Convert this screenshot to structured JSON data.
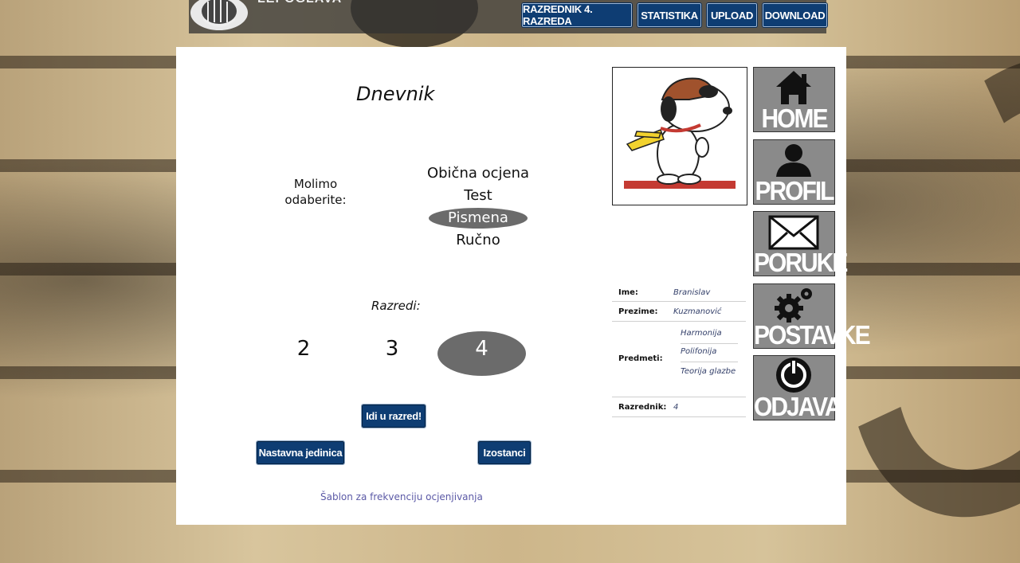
{
  "header": {
    "logo_text": "LEPOGLAVA",
    "nav": [
      "RAZREDNIK 4. RAZREDA",
      "STATISTIKA",
      "UPLOAD",
      "DOWNLOAD"
    ]
  },
  "main": {
    "title": "Dnevnik",
    "prompt": "Molimo odaberite:",
    "options": [
      "Obična ocjena",
      "Test",
      "Pismena",
      "Ručno"
    ],
    "selected_option": "Pismena",
    "grades_label": "Razredi:",
    "grades": [
      "2",
      "3",
      "4"
    ],
    "selected_grade": "4",
    "go_button": "Idi u razred!",
    "lesson_button": "Nastavna jedinica",
    "absence_button": "Izostanci",
    "template_link": "Šablon za frekvenciju ocjenjivanja"
  },
  "profile": {
    "name_label": "Ime:",
    "name": "Branislav",
    "surname_label": "Prezime:",
    "surname": "Kuzmanović",
    "subjects_label": "Predmeti:",
    "subjects": [
      "Harmonija",
      "Polifonija",
      "Teorija glazbe"
    ],
    "class_teacher_label": "Razrednik:",
    "class_teacher": "4"
  },
  "side_menu": [
    "HOME",
    "PROFIL",
    "PORUKE",
    "POSTAVKE",
    "ODJAVA"
  ],
  "colors": {
    "nav_blue": "#0e3d73",
    "selected_grey": "#6b6b6b",
    "tile_grey": "#8a8a8a",
    "link": "#5b59a6"
  }
}
